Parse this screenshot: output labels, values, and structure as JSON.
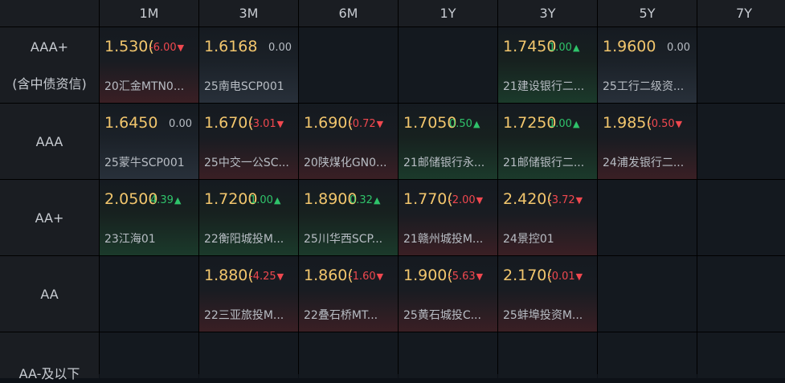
{
  "tenors": [
    "1M",
    "3M",
    "6M",
    "1Y",
    "3Y",
    "5Y",
    "7Y"
  ],
  "ratings": [
    {
      "label1": "AAA+",
      "label2": "(含中债资信)"
    },
    {
      "label1": "AAA",
      "label2": ""
    },
    {
      "label1": "AA+",
      "label2": ""
    },
    {
      "label1": "AA",
      "label2": ""
    },
    {
      "label1": "AA-及以下",
      "label2": ""
    }
  ],
  "rows": [
    [
      {
        "rate": "1.530(",
        "chg": "-6.00",
        "dir": "down",
        "name": "20汇金MTN0..."
      },
      {
        "rate": "1.6168",
        "chg": "0.00",
        "dir": "flat",
        "name": "25南电SCP001"
      },
      null,
      null,
      {
        "rate": "1.7450",
        "chg": "1.00",
        "dir": "up",
        "name": "21建设银行二..."
      },
      {
        "rate": "1.9600",
        "chg": "0.00",
        "dir": "flat",
        "name": "25工行二级资..."
      },
      null
    ],
    [
      {
        "rate": "1.6450",
        "chg": "0.00",
        "dir": "flat",
        "name": "25蒙牛SCP001"
      },
      {
        "rate": "1.670(",
        "chg": "-3.01",
        "dir": "down",
        "name": "25中交一公SC..."
      },
      {
        "rate": "1.690(",
        "chg": "-0.72",
        "dir": "down",
        "name": "20陕煤化GN0..."
      },
      {
        "rate": "1.7050",
        "chg": "0.50",
        "dir": "up",
        "name": "21邮储银行永..."
      },
      {
        "rate": "1.7250",
        "chg": "1.00",
        "dir": "up",
        "name": "21邮储银行二..."
      },
      {
        "rate": "1.985(",
        "chg": "-0.50",
        "dir": "down",
        "name": "24浦发银行二..."
      },
      null
    ],
    [
      {
        "rate": "2.0500",
        "chg": "4.39",
        "dir": "up",
        "name": "23江海01"
      },
      {
        "rate": "1.7200",
        "chg": "1.00",
        "dir": "up",
        "name": "22衡阳城投M..."
      },
      {
        "rate": "1.8900",
        "chg": "0.32",
        "dir": "up",
        "name": "25川华西SCP..."
      },
      {
        "rate": "1.770(",
        "chg": "-2.00",
        "dir": "down",
        "name": "21赣州城投M..."
      },
      {
        "rate": "2.420(",
        "chg": "-3.72",
        "dir": "down",
        "name": "24景控01"
      },
      null,
      null
    ],
    [
      null,
      {
        "rate": "1.880(",
        "chg": "-4.25",
        "dir": "down",
        "name": "22三亚旅投M..."
      },
      {
        "rate": "1.860(",
        "chg": "-1.60",
        "dir": "down",
        "name": "22叠石桥MT..."
      },
      {
        "rate": "1.900(",
        "chg": "-5.63",
        "dir": "down",
        "name": "25黄石城投C..."
      },
      {
        "rate": "2.170(",
        "chg": "-0.01",
        "dir": "down",
        "name": "25蚌埠投资M..."
      },
      null,
      null
    ],
    [
      null,
      null,
      null,
      null,
      null,
      null,
      null
    ]
  ],
  "colors": {
    "rate": "#f2c66d",
    "up": "#2fc36a",
    "down": "#f0484f",
    "flat": "#b8bdc4"
  },
  "icons": {
    "up": "triangle-up-icon",
    "down": "triangle-down-icon"
  }
}
